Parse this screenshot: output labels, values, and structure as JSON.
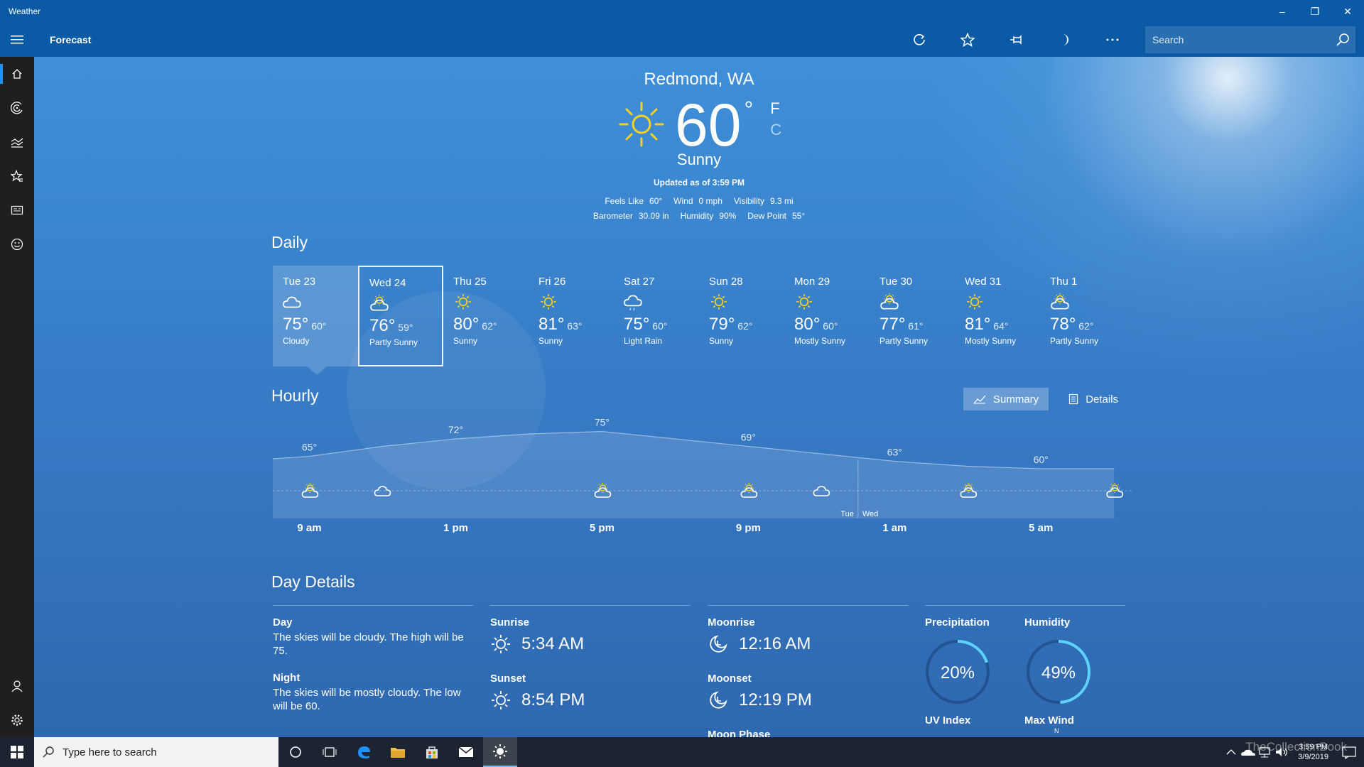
{
  "window": {
    "title": "Weather",
    "minimize": "–",
    "restore": "❐",
    "close": "✕"
  },
  "header": {
    "title": "Forecast",
    "search_placeholder": "Search",
    "buttons": [
      "refresh-icon",
      "favorite-icon",
      "pin-icon",
      "dark-mode-icon",
      "more-icon"
    ]
  },
  "rail": [
    "home-icon",
    "maps-icon",
    "historical-icon",
    "places-icon",
    "news-icon",
    "feedback-icon"
  ],
  "current": {
    "location": "Redmond, WA",
    "temp": "60",
    "deg": "°",
    "unit_f": "F",
    "unit_c": "C",
    "condition": "Sunny",
    "updated": "Updated as of 3:59 PM",
    "stats_row1": [
      {
        "label": "Feels Like",
        "value": "60°"
      },
      {
        "label": "Wind",
        "value": "0 mph"
      },
      {
        "label": "Visibility",
        "value": "9.3 mi"
      }
    ],
    "stats_row2": [
      {
        "label": "Barometer",
        "value": "30.09 in"
      },
      {
        "label": "Humidity",
        "value": "90%"
      },
      {
        "label": "Dew Point",
        "value": "55°"
      }
    ]
  },
  "daily": {
    "title": "Daily",
    "days": [
      {
        "name": "Tue 23",
        "hi": "75°",
        "lo": "60°",
        "cond": "Cloudy",
        "icon": "cloudy"
      },
      {
        "name": "Wed 24",
        "hi": "76°",
        "lo": "59°",
        "cond": "Partly Sunny",
        "icon": "partly"
      },
      {
        "name": "Thu 25",
        "hi": "80°",
        "lo": "62°",
        "cond": "Sunny",
        "icon": "sunny"
      },
      {
        "name": "Fri 26",
        "hi": "81°",
        "lo": "63°",
        "cond": "Sunny",
        "icon": "sunny"
      },
      {
        "name": "Sat 27",
        "hi": "75°",
        "lo": "60°",
        "cond": "Light Rain",
        "icon": "rain"
      },
      {
        "name": "Sun 28",
        "hi": "79°",
        "lo": "62°",
        "cond": "Sunny",
        "icon": "sunny"
      },
      {
        "name": "Mon 29",
        "hi": "80°",
        "lo": "60°",
        "cond": "Mostly Sunny",
        "icon": "sunny"
      },
      {
        "name": "Tue 30",
        "hi": "77°",
        "lo": "61°",
        "cond": "Partly Sunny",
        "icon": "partly"
      },
      {
        "name": "Wed 31",
        "hi": "81°",
        "lo": "64°",
        "cond": "Mostly Sunny",
        "icon": "sunny"
      },
      {
        "name": "Thu 1",
        "hi": "78°",
        "lo": "62°",
        "cond": "Partly Sunny",
        "icon": "partly"
      }
    ]
  },
  "hourly": {
    "title": "Hourly",
    "summary_label": "Summary",
    "details_label": "Details",
    "times": [
      "9 am",
      "1 pm",
      "5 pm",
      "9 pm",
      "1 am",
      "5 am"
    ],
    "day_marks": [
      "Tue",
      "Wed"
    ],
    "temp_labels": [
      {
        "hour": 9,
        "value": "65°"
      },
      {
        "hour": 13,
        "value": "72°"
      },
      {
        "hour": 17,
        "value": "75°"
      },
      {
        "hour": 21,
        "value": "69°"
      },
      {
        "hour": 25,
        "value": "63°"
      },
      {
        "hour": 29,
        "value": "60°"
      }
    ],
    "curve": [
      [
        8,
        64
      ],
      [
        9,
        65
      ],
      [
        11,
        69
      ],
      [
        13,
        72
      ],
      [
        15,
        74
      ],
      [
        17,
        75
      ],
      [
        19,
        72
      ],
      [
        21,
        69
      ],
      [
        23,
        66
      ],
      [
        25,
        63
      ],
      [
        27,
        61
      ],
      [
        29,
        60
      ],
      [
        31,
        60
      ]
    ],
    "icons": [
      {
        "hour": 9,
        "icon": "partly"
      },
      {
        "hour": 11,
        "icon": "cloudy"
      },
      {
        "hour": 17,
        "icon": "partly"
      },
      {
        "hour": 21,
        "icon": "partly"
      },
      {
        "hour": 23,
        "icon": "cloudy"
      },
      {
        "hour": 27,
        "icon": "partly"
      },
      {
        "hour": 31,
        "icon": "partly"
      }
    ]
  },
  "details": {
    "title": "Day Details",
    "day_label": "Day",
    "day_text": "The skies will be cloudy. The high will be 75.",
    "night_label": "Night",
    "night_text": "The skies will be mostly cloudy. The low will be 60.",
    "sunrise_label": "Sunrise",
    "sunrise": "5:34 AM",
    "sunset_label": "Sunset",
    "sunset": "8:54 PM",
    "moonrise_label": "Moonrise",
    "moonrise": "12:16 AM",
    "moonset_label": "Moonset",
    "moonset": "12:19 PM",
    "moonphase_label": "Moon Phase",
    "precip_label": "Precipitation",
    "precip": "20%",
    "precip_value": 0.2,
    "humidity_label": "Humidity",
    "humidity": "49%",
    "humidity_value": 0.49,
    "uv_label": "UV Index",
    "wind_label": "Max Wind",
    "wind_dir": "N"
  },
  "taskbar": {
    "search_placeholder": "Type here to search",
    "time": "3:59 PM",
    "date": "3/9/2019",
    "watermark": "TheCollectionBook"
  },
  "colors": {
    "accent": "#0b5aa6",
    "sun": "#f7d21a",
    "gauge": "#5fd3ff"
  }
}
